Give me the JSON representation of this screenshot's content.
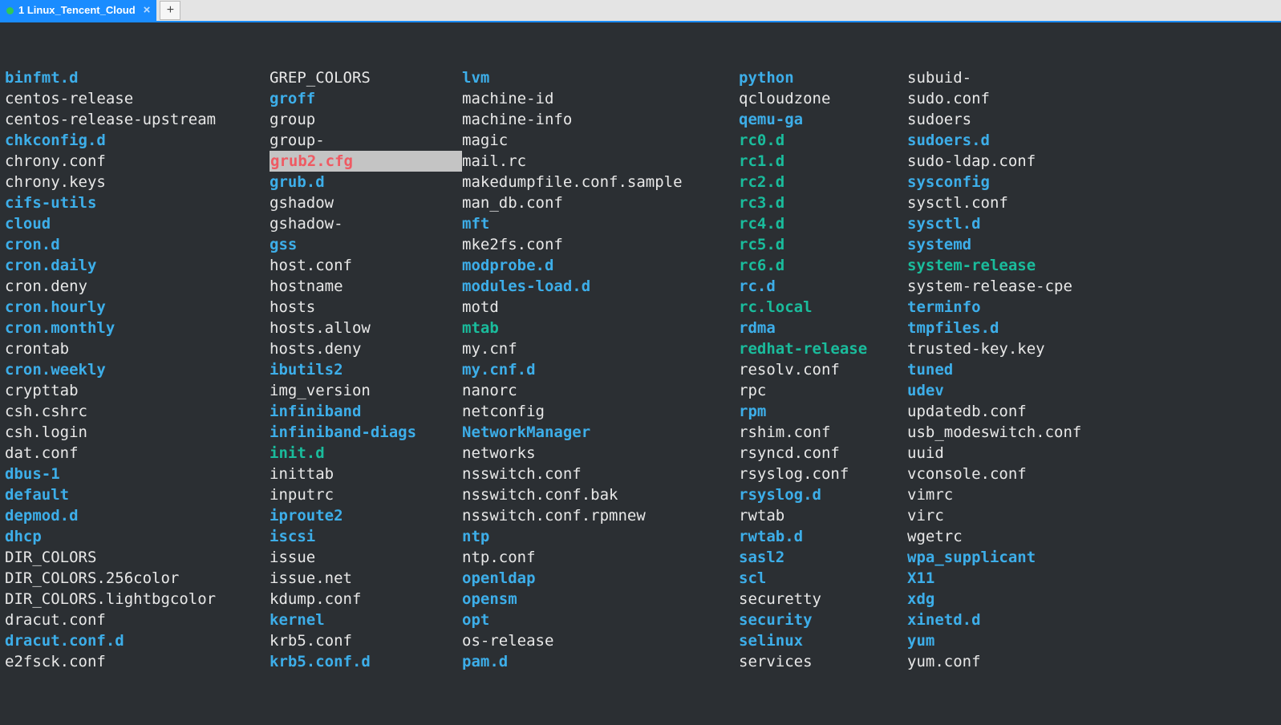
{
  "tabbar": {
    "active_tab_label": "1 Linux_Tencent_Cloud",
    "new_tab_glyph": "+",
    "close_glyph": "×"
  },
  "listing": {
    "columns": [
      [
        {
          "name": "binfmt.d",
          "kind": "dir"
        },
        {
          "name": "centos-release",
          "kind": "plain"
        },
        {
          "name": "centos-release-upstream",
          "kind": "plain"
        },
        {
          "name": "chkconfig.d",
          "kind": "dir"
        },
        {
          "name": "chrony.conf",
          "kind": "plain"
        },
        {
          "name": "chrony.keys",
          "kind": "plain"
        },
        {
          "name": "cifs-utils",
          "kind": "dir"
        },
        {
          "name": "cloud",
          "kind": "dir"
        },
        {
          "name": "cron.d",
          "kind": "dir"
        },
        {
          "name": "cron.daily",
          "kind": "dir"
        },
        {
          "name": "cron.deny",
          "kind": "plain"
        },
        {
          "name": "cron.hourly",
          "kind": "dir"
        },
        {
          "name": "cron.monthly",
          "kind": "dir"
        },
        {
          "name": "crontab",
          "kind": "plain"
        },
        {
          "name": "cron.weekly",
          "kind": "dir"
        },
        {
          "name": "crypttab",
          "kind": "plain"
        },
        {
          "name": "csh.cshrc",
          "kind": "plain"
        },
        {
          "name": "csh.login",
          "kind": "plain"
        },
        {
          "name": "dat.conf",
          "kind": "plain"
        },
        {
          "name": "dbus-1",
          "kind": "dir"
        },
        {
          "name": "default",
          "kind": "dir"
        },
        {
          "name": "depmod.d",
          "kind": "dir"
        },
        {
          "name": "dhcp",
          "kind": "dir"
        },
        {
          "name": "DIR_COLORS",
          "kind": "plain"
        },
        {
          "name": "DIR_COLORS.256color",
          "kind": "plain"
        },
        {
          "name": "DIR_COLORS.lightbgcolor",
          "kind": "plain"
        },
        {
          "name": "dracut.conf",
          "kind": "plain"
        },
        {
          "name": "dracut.conf.d",
          "kind": "dir"
        },
        {
          "name": "e2fsck.conf",
          "kind": "plain"
        }
      ],
      [
        {
          "name": "GREP_COLORS",
          "kind": "plain"
        },
        {
          "name": "groff",
          "kind": "dir"
        },
        {
          "name": "group",
          "kind": "plain"
        },
        {
          "name": "group-",
          "kind": "plain"
        },
        {
          "name": "grub2.cfg",
          "kind": "hl"
        },
        {
          "name": "grub.d",
          "kind": "dir"
        },
        {
          "name": "gshadow",
          "kind": "plain"
        },
        {
          "name": "gshadow-",
          "kind": "plain"
        },
        {
          "name": "gss",
          "kind": "dir"
        },
        {
          "name": "host.conf",
          "kind": "plain"
        },
        {
          "name": "hostname",
          "kind": "plain"
        },
        {
          "name": "hosts",
          "kind": "plain"
        },
        {
          "name": "hosts.allow",
          "kind": "plain"
        },
        {
          "name": "hosts.deny",
          "kind": "plain"
        },
        {
          "name": "ibutils2",
          "kind": "dir"
        },
        {
          "name": "img_version",
          "kind": "plain"
        },
        {
          "name": "infiniband",
          "kind": "dir"
        },
        {
          "name": "infiniband-diags",
          "kind": "dir"
        },
        {
          "name": "init.d",
          "kind": "link"
        },
        {
          "name": "inittab",
          "kind": "plain"
        },
        {
          "name": "inputrc",
          "kind": "plain"
        },
        {
          "name": "iproute2",
          "kind": "dir"
        },
        {
          "name": "iscsi",
          "kind": "dir"
        },
        {
          "name": "issue",
          "kind": "plain"
        },
        {
          "name": "issue.net",
          "kind": "plain"
        },
        {
          "name": "kdump.conf",
          "kind": "plain"
        },
        {
          "name": "kernel",
          "kind": "dir"
        },
        {
          "name": "krb5.conf",
          "kind": "plain"
        },
        {
          "name": "krb5.conf.d",
          "kind": "dir"
        }
      ],
      [
        {
          "name": "lvm",
          "kind": "dir"
        },
        {
          "name": "machine-id",
          "kind": "plain"
        },
        {
          "name": "machine-info",
          "kind": "plain"
        },
        {
          "name": "magic",
          "kind": "plain"
        },
        {
          "name": "mail.rc",
          "kind": "plain"
        },
        {
          "name": "makedumpfile.conf.sample",
          "kind": "plain"
        },
        {
          "name": "man_db.conf",
          "kind": "plain"
        },
        {
          "name": "mft",
          "kind": "dir"
        },
        {
          "name": "mke2fs.conf",
          "kind": "plain"
        },
        {
          "name": "modprobe.d",
          "kind": "dir"
        },
        {
          "name": "modules-load.d",
          "kind": "dir"
        },
        {
          "name": "motd",
          "kind": "plain"
        },
        {
          "name": "mtab",
          "kind": "link"
        },
        {
          "name": "my.cnf",
          "kind": "plain"
        },
        {
          "name": "my.cnf.d",
          "kind": "dir"
        },
        {
          "name": "nanorc",
          "kind": "plain"
        },
        {
          "name": "netconfig",
          "kind": "plain"
        },
        {
          "name": "NetworkManager",
          "kind": "dir"
        },
        {
          "name": "networks",
          "kind": "plain"
        },
        {
          "name": "nsswitch.conf",
          "kind": "plain"
        },
        {
          "name": "nsswitch.conf.bak",
          "kind": "plain"
        },
        {
          "name": "nsswitch.conf.rpmnew",
          "kind": "plain"
        },
        {
          "name": "ntp",
          "kind": "dir"
        },
        {
          "name": "ntp.conf",
          "kind": "plain"
        },
        {
          "name": "openldap",
          "kind": "dir"
        },
        {
          "name": "opensm",
          "kind": "dir"
        },
        {
          "name": "opt",
          "kind": "dir"
        },
        {
          "name": "os-release",
          "kind": "plain"
        },
        {
          "name": "pam.d",
          "kind": "dir"
        }
      ],
      [
        {
          "name": "python",
          "kind": "dir"
        },
        {
          "name": "qcloudzone",
          "kind": "plain"
        },
        {
          "name": "qemu-ga",
          "kind": "dir"
        },
        {
          "name": "rc0.d",
          "kind": "link"
        },
        {
          "name": "rc1.d",
          "kind": "link"
        },
        {
          "name": "rc2.d",
          "kind": "link"
        },
        {
          "name": "rc3.d",
          "kind": "link"
        },
        {
          "name": "rc4.d",
          "kind": "link"
        },
        {
          "name": "rc5.d",
          "kind": "link"
        },
        {
          "name": "rc6.d",
          "kind": "link"
        },
        {
          "name": "rc.d",
          "kind": "dir"
        },
        {
          "name": "rc.local",
          "kind": "link"
        },
        {
          "name": "rdma",
          "kind": "dir"
        },
        {
          "name": "redhat-release",
          "kind": "link"
        },
        {
          "name": "resolv.conf",
          "kind": "plain"
        },
        {
          "name": "rpc",
          "kind": "plain"
        },
        {
          "name": "rpm",
          "kind": "dir"
        },
        {
          "name": "rshim.conf",
          "kind": "plain"
        },
        {
          "name": "rsyncd.conf",
          "kind": "plain"
        },
        {
          "name": "rsyslog.conf",
          "kind": "plain"
        },
        {
          "name": "rsyslog.d",
          "kind": "dir"
        },
        {
          "name": "rwtab",
          "kind": "plain"
        },
        {
          "name": "rwtab.d",
          "kind": "dir"
        },
        {
          "name": "sasl2",
          "kind": "dir"
        },
        {
          "name": "scl",
          "kind": "dir"
        },
        {
          "name": "securetty",
          "kind": "plain"
        },
        {
          "name": "security",
          "kind": "dir"
        },
        {
          "name": "selinux",
          "kind": "dir"
        },
        {
          "name": "services",
          "kind": "plain"
        }
      ],
      [
        {
          "name": "subuid-",
          "kind": "plain"
        },
        {
          "name": "sudo.conf",
          "kind": "plain"
        },
        {
          "name": "sudoers",
          "kind": "plain"
        },
        {
          "name": "sudoers.d",
          "kind": "dir"
        },
        {
          "name": "sudo-ldap.conf",
          "kind": "plain"
        },
        {
          "name": "sysconfig",
          "kind": "dir"
        },
        {
          "name": "sysctl.conf",
          "kind": "plain"
        },
        {
          "name": "sysctl.d",
          "kind": "dir"
        },
        {
          "name": "systemd",
          "kind": "dir"
        },
        {
          "name": "system-release",
          "kind": "link"
        },
        {
          "name": "system-release-cpe",
          "kind": "plain"
        },
        {
          "name": "terminfo",
          "kind": "dir"
        },
        {
          "name": "tmpfiles.d",
          "kind": "dir"
        },
        {
          "name": "trusted-key.key",
          "kind": "plain"
        },
        {
          "name": "tuned",
          "kind": "dir"
        },
        {
          "name": "udev",
          "kind": "dir"
        },
        {
          "name": "updatedb.conf",
          "kind": "plain"
        },
        {
          "name": "usb_modeswitch.conf",
          "kind": "plain"
        },
        {
          "name": "uuid",
          "kind": "plain"
        },
        {
          "name": "vconsole.conf",
          "kind": "plain"
        },
        {
          "name": "vimrc",
          "kind": "plain"
        },
        {
          "name": "virc",
          "kind": "plain"
        },
        {
          "name": "wgetrc",
          "kind": "plain"
        },
        {
          "name": "wpa_supplicant",
          "kind": "dir"
        },
        {
          "name": "X11",
          "kind": "dir"
        },
        {
          "name": "xdg",
          "kind": "dir"
        },
        {
          "name": "xinetd.d",
          "kind": "dir"
        },
        {
          "name": "yum",
          "kind": "dir"
        },
        {
          "name": "yum.conf",
          "kind": "plain"
        }
      ]
    ]
  },
  "colors": {
    "tab_active_bg": "#1a8cff",
    "term_bg": "#2b2f33",
    "dir_fg": "#3daee9",
    "link_fg": "#1abc9c",
    "hl_fg": "#ef5a63",
    "hl_bg": "#c4c4c4",
    "text_fg": "#e8e8e8"
  }
}
